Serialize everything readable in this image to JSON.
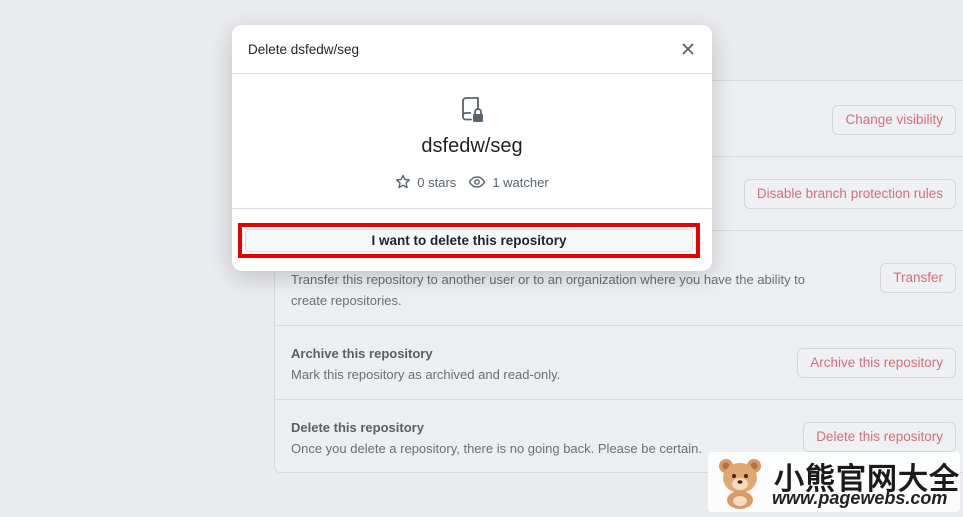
{
  "danger_zone": {
    "change_visibility_label": "Change visibility",
    "disable_branch_protection_label": "Disable branch protection rules",
    "transfer": {
      "desc_line1": "Transfer this repository to another user or to an organization where you have the ability to",
      "desc_line2": "create repositories.",
      "button": "Transfer"
    },
    "archive": {
      "title": "Archive this repository",
      "desc": "Mark this repository as archived and read-only.",
      "button": "Archive this repository"
    },
    "delete": {
      "title": "Delete this repository",
      "desc": "Once you delete a repository, there is no going back. Please be certain.",
      "button": "Delete this repository"
    }
  },
  "modal": {
    "title": "Delete dsfedw/seg",
    "repo_name": "dsfedw/seg",
    "stars": "0 stars",
    "watchers": "1 watcher",
    "confirm_label": "I want to delete this repository",
    "icons": {
      "close": "close-icon",
      "repo": "repo-locked-icon",
      "star": "star-icon",
      "eye": "eye-icon"
    }
  },
  "watermark": {
    "brand_text": "小熊官网大全",
    "url": "www.pagewebs.com"
  },
  "colors": {
    "danger_text": "#d1707a",
    "highlight_border": "#e60000"
  }
}
